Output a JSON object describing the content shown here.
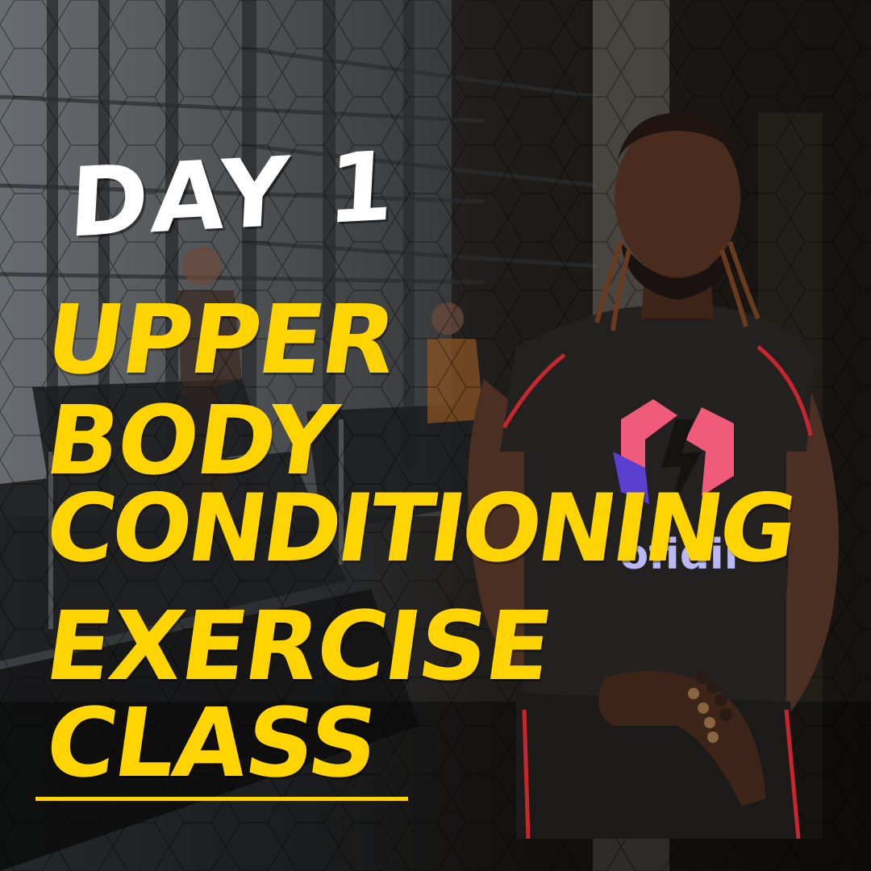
{
  "poster": {
    "day_label": "DAY 1",
    "title_lines": [
      "UPPER",
      "BODY",
      "CONDITIONING",
      "EXERCISE",
      "CLASS"
    ],
    "shirt_logo_text": "ofidii"
  },
  "colors": {
    "title_yellow": "#ffd400",
    "day_white": "#ffffff",
    "shirt_black": "#232120",
    "shirt_trim_red": "#c7262d",
    "logo_pink": "#ef5b78",
    "logo_purple": "#5b3fd0",
    "logo_text_blue": "#b9b8f2"
  },
  "icons": {
    "shirt_logo": "lightning-bolt-hexagon-icon"
  }
}
